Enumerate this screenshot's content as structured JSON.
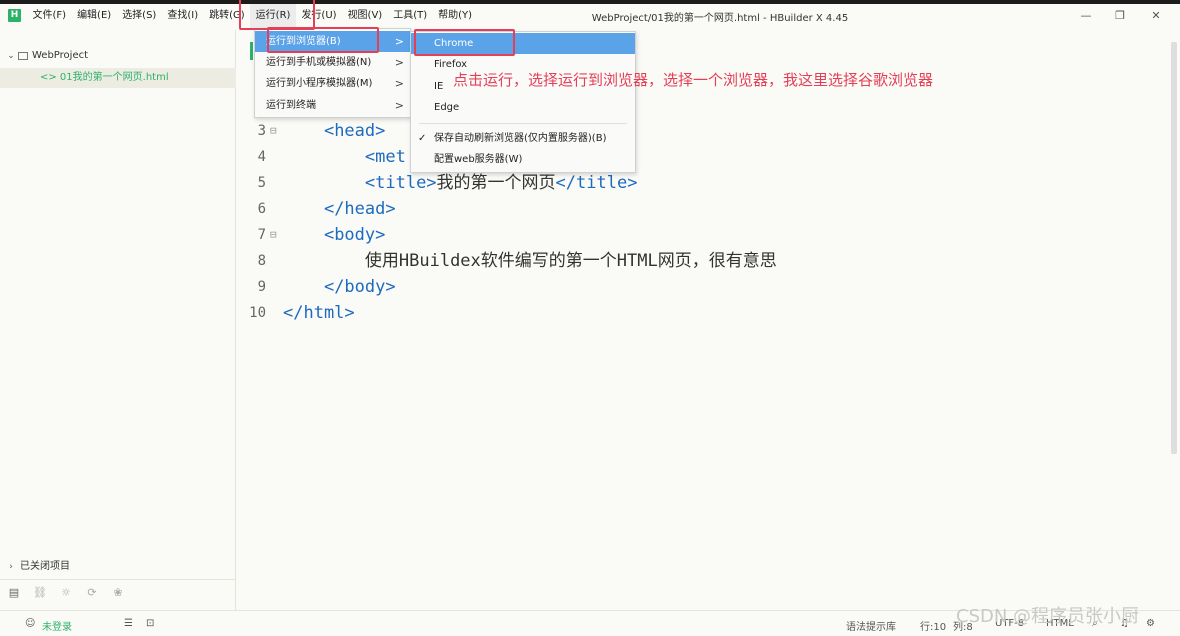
{
  "menubar": [
    "文件(F)",
    "编辑(E)",
    "选择(S)",
    "查找(I)",
    "跳转(G)",
    "运行(R)",
    "发行(U)",
    "视图(V)",
    "工具(T)",
    "帮助(Y)"
  ],
  "logo": "H",
  "window_title": "WebProject/01我的第一个网页.html - HBuilder X 4.45",
  "window_controls": {
    "minimize": "—",
    "restore": "❐",
    "close": "✕"
  },
  "sidebar": {
    "project": "WebProject",
    "file": "<> 01我的第一个网页.html",
    "closed_projects": "已关闭项目"
  },
  "bottom_icons": [
    "▤",
    "⛓",
    "☼",
    "⟳",
    "❀"
  ],
  "run_menu": {
    "items": [
      {
        "label": "运行到浏览器(B)",
        "arrow": ">"
      },
      {
        "label": "运行到手机或模拟器(N)",
        "arrow": ">"
      },
      {
        "label": "运行到小程序模拟器(M)",
        "arrow": ">"
      },
      {
        "label": "运行到终端",
        "arrow": ">"
      }
    ]
  },
  "browser_menu": {
    "items": [
      "Chrome",
      "Firefox",
      "IE",
      "Edge"
    ],
    "auto_refresh": "保存自动刷新浏览器(仅内置服务器)(B)",
    "config": "配置web服务器(W)",
    "check": "✓"
  },
  "annotation": "点击运行，选择运行到浏览器，选择一个浏览器，我这里选择谷歌浏览器",
  "code": {
    "lines": [
      {
        "num": "3",
        "fold": "⊟",
        "indent": "    ",
        "tag_open": "<head>",
        "text": "",
        "tag_close": ""
      },
      {
        "num": "4",
        "fold": "",
        "indent": "        ",
        "tag_open": "<met",
        "text": "",
        "tag_close": ""
      },
      {
        "num": "5",
        "fold": "",
        "indent": "        ",
        "tag_open": "<title>",
        "text": "我的第一个网页",
        "tag_close": "</title>"
      },
      {
        "num": "6",
        "fold": "",
        "indent": "    ",
        "tag_open": "</head>",
        "text": "",
        "tag_close": ""
      },
      {
        "num": "7",
        "fold": "⊟",
        "indent": "    ",
        "tag_open": "<body>",
        "text": "",
        "tag_close": ""
      },
      {
        "num": "8",
        "fold": "",
        "indent": "        ",
        "tag_open": "",
        "text": "使用HBuildex软件编写的第一个HTML网页，很有意思",
        "tag_close": ""
      },
      {
        "num": "9",
        "fold": "",
        "indent": "    ",
        "tag_open": "</body>",
        "text": "",
        "tag_close": ""
      },
      {
        "num": "10",
        "fold": "",
        "indent": "",
        "tag_open": "</html>",
        "text": "",
        "tag_close": ""
      }
    ]
  },
  "statusbar": {
    "login": "未登录",
    "grammar": "语法提示库",
    "row": "行:10",
    "col": "列:8",
    "encoding": "UTF-8",
    "lang": "HTML"
  },
  "watermark": "CSDN @程序员张小厨",
  "colors": {
    "accent": "#2db26a",
    "highlight": "#5ba3e8",
    "annotation": "#e53f57",
    "tag": "#1d6ac0"
  }
}
